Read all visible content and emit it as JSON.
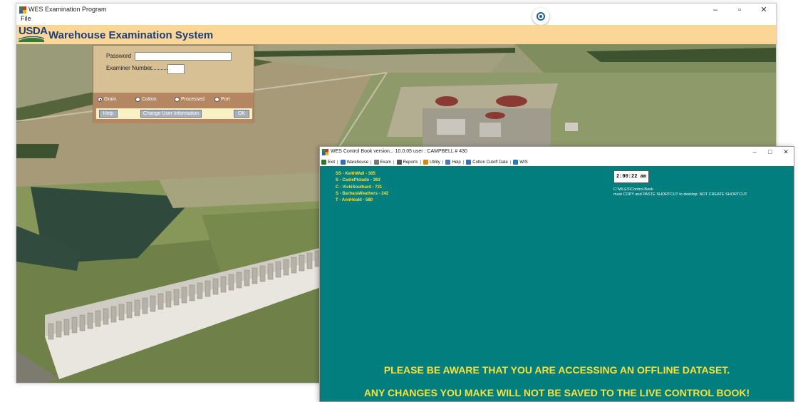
{
  "main_window": {
    "title": "WES Examination Program",
    "menu_file": "File",
    "controls": {
      "minimize": "–",
      "maximize": "▫",
      "close": "✕"
    }
  },
  "banner": {
    "logo_text": "USDA",
    "title": "Warehouse Examination System"
  },
  "login": {
    "password_label": "Password",
    "password_value": "",
    "examiner_label": "Examiner Number",
    "examiner_value": "",
    "radios": [
      {
        "label": "Grain",
        "selected": true
      },
      {
        "label": "Cotton",
        "selected": false
      },
      {
        "label": "Processed",
        "selected": false
      },
      {
        "label": "Port",
        "selected": false
      }
    ],
    "btn_left": "Help",
    "btn_mid": "Change User Information",
    "btn_ok": "OK"
  },
  "control_book": {
    "title": "WES Control Book  version... 10.0.05  user :  CAMPBELL # 430",
    "controls": {
      "minimize": "–",
      "maximize": "□",
      "close": "✕"
    },
    "toolbar": [
      {
        "label": "Exit",
        "icon": "exit-icon",
        "color": "#2a7a2a"
      },
      {
        "label": "Warehouse",
        "icon": "warehouse-icon",
        "color": "#3c6fb0"
      },
      {
        "label": "Exam",
        "icon": "exam-icon",
        "color": "#7a7a7a"
      },
      {
        "label": "Reports",
        "icon": "printer-icon",
        "color": "#555555"
      },
      {
        "label": "Utility",
        "icon": "utility-icon",
        "color": "#d08a1a"
      },
      {
        "label": "Help",
        "icon": "help-icon",
        "color": "#4a7ab8"
      },
      {
        "label": "Cotton Cutoff Date",
        "icon": "calendar-icon",
        "color": "#3c6fb0"
      },
      {
        "label": "WIS",
        "icon": "wis-icon",
        "color": "#2a7ab0"
      }
    ],
    "staff": [
      "SS - KeithWall - 305",
      "S - CaolePlolado - 363",
      "C - VickiSouthard - 721",
      "S - BarbaraWeathers - 242",
      "T - AnnHeald - 580"
    ],
    "clock": "2:00:22 am",
    "path_line1": "C:\\WLES\\Control.Book",
    "path_line2": "must COPY and PASTE SHORTCUT to desktop. NOT CREATE SHORTCUT",
    "warning1": "PLEASE BE AWARE THAT YOU ARE ACCESSING AN OFFLINE DATASET.",
    "warning2": "ANY CHANGES YOU MAKE WILL NOT BE SAVED TO THE LIVE CONTROL BOOK!"
  },
  "colors": {
    "banner": "#fbd697",
    "usda_blue": "#1b3f7a",
    "control_book_bg": "#027e7e",
    "warning_text": "#f8e23a"
  }
}
